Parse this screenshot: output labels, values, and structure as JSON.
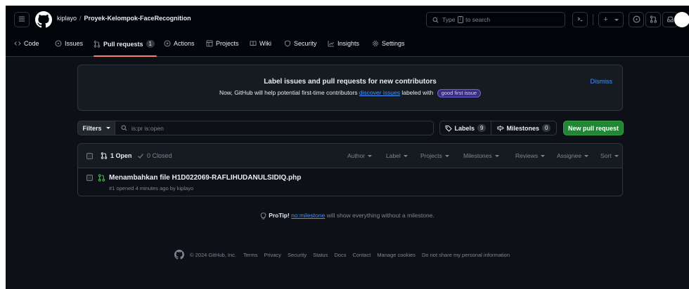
{
  "header": {
    "owner": "kiplayo",
    "separator": "/",
    "repo": "Proyek-Kelompok-FaceRecognition",
    "search": {
      "before": "Type",
      "key": "/",
      "after": "to search"
    },
    "plus_label": "+"
  },
  "tabs": [
    {
      "label": "Code"
    },
    {
      "label": "Issues"
    },
    {
      "label": "Pull requests",
      "count": "1"
    },
    {
      "label": "Actions"
    },
    {
      "label": "Projects"
    },
    {
      "label": "Wiki"
    },
    {
      "label": "Security"
    },
    {
      "label": "Insights"
    },
    {
      "label": "Settings"
    }
  ],
  "banner": {
    "title": "Label issues and pull requests for new contributors",
    "text_before": "Now, GitHub will help potential first-time contributors",
    "link": "discover issues",
    "text_after": "labeled with",
    "label": "good first issue",
    "dismiss": "Dismiss"
  },
  "filters": {
    "button": "Filters",
    "query": "is:pr is:open",
    "labels": "Labels",
    "labels_count": "9",
    "milestones": "Milestones",
    "milestones_count": "0",
    "new_pr": "New pull request"
  },
  "list": {
    "open": "1 Open",
    "closed": "0 Closed",
    "sorts": [
      "Author",
      "Label",
      "Projects",
      "Milestones",
      "Reviews",
      "Assignee",
      "Sort"
    ],
    "items": [
      {
        "title": "Menambahkan file H1D022069-RAFLIHUDANULSIDIQ.php",
        "meta": "#1 opened 4 minutes ago by kiplayo"
      }
    ]
  },
  "protip": {
    "label": "ProTip!",
    "link": "no:milestone",
    "text": "will show everything without a milestone."
  },
  "footer": {
    "copyright": "© 2024 GitHub, Inc.",
    "links": [
      "Terms",
      "Privacy",
      "Security",
      "Status",
      "Docs",
      "Contact",
      "Manage cookies",
      "Do not share my personal information"
    ]
  },
  "colors": {
    "background": "#0d1117",
    "header": "#010409",
    "border": "#30363d",
    "accent_underline": "#f78166",
    "link": "#4493f8",
    "open_green": "#3fb950",
    "button_green": "#238636"
  }
}
